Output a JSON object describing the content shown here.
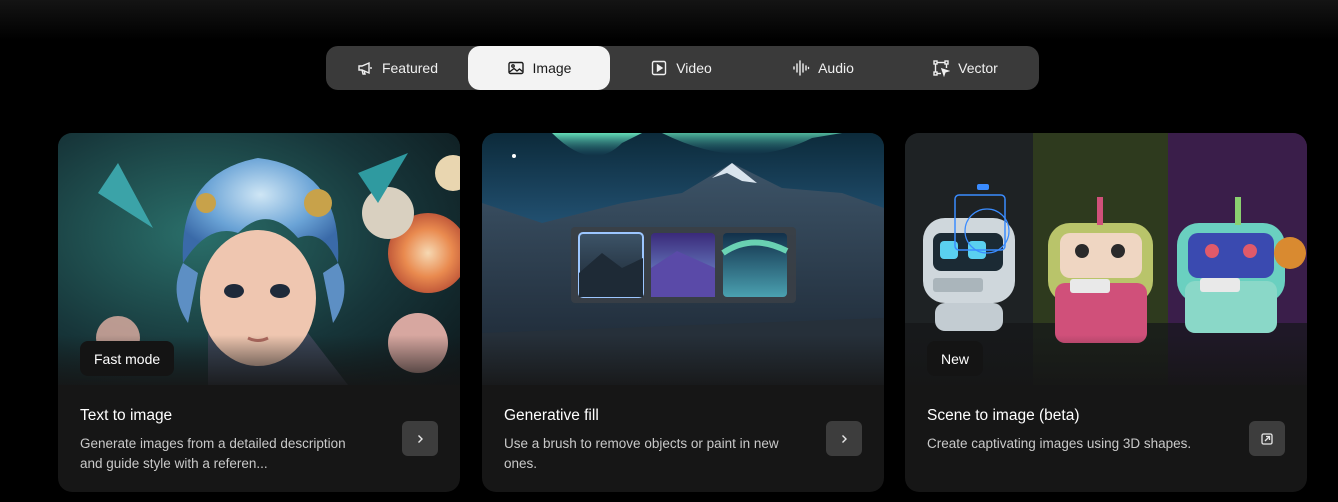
{
  "tabs": [
    {
      "label": "Featured",
      "icon": "megaphone-icon"
    },
    {
      "label": "Image",
      "icon": "image-icon"
    },
    {
      "label": "Video",
      "icon": "video-icon"
    },
    {
      "label": "Audio",
      "icon": "audio-waveform-icon"
    },
    {
      "label": "Vector",
      "icon": "vector-icon"
    }
  ],
  "active_tab": "Image",
  "cards": [
    {
      "badge": "Fast mode",
      "title": "Text to image",
      "description": "Generate images from a detailed description and guide style with a referen...",
      "action_icon": "chevron-right-icon"
    },
    {
      "badge": "",
      "title": "Generative fill",
      "description": "Use a brush to remove objects or paint in new ones.",
      "action_icon": "chevron-right-icon"
    },
    {
      "badge": "New",
      "title": "Scene to image (beta)",
      "description": "Create captivating images using 3D shapes.",
      "action_icon": "external-open-icon"
    }
  ],
  "colors": {
    "background": "#000000",
    "tabbar": "#3a3a3a",
    "active_tab": "#f3f3f3",
    "card": "#161616",
    "button": "#3d3d3d"
  }
}
